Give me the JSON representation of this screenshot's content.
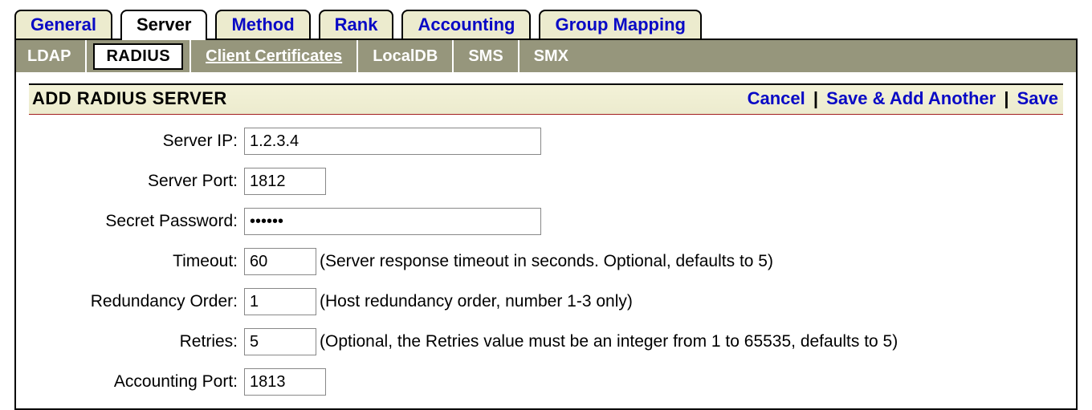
{
  "tabs": {
    "general": "General",
    "server": "Server",
    "method": "Method",
    "rank": "Rank",
    "accounting": "Accounting",
    "group_mapping": "Group Mapping"
  },
  "subtabs": {
    "ldap": "LDAP",
    "radius": "RADIUS",
    "clientc": "Client Certificates",
    "localdb": "LocalDB",
    "sms": "SMS",
    "smx": "SMX"
  },
  "header": {
    "title": "ADD RADIUS SERVER",
    "cancel": "Cancel",
    "save_add": "Save & Add Another",
    "save": "Save",
    "sep": "|"
  },
  "form": {
    "server_ip": {
      "label": "Server IP:",
      "value": "1.2.3.4"
    },
    "server_port": {
      "label": "Server Port:",
      "value": "1812"
    },
    "secret_password": {
      "label": "Secret Password:",
      "value": "xxxxxx"
    },
    "timeout": {
      "label": "Timeout:",
      "value": "60",
      "hint": "(Server response timeout in seconds. Optional, defaults to 5)"
    },
    "redundancy": {
      "label": "Redundancy Order:",
      "value": "1",
      "hint": "(Host redundancy order, number 1-3 only)"
    },
    "retries": {
      "label": "Retries:",
      "value": "5",
      "hint": "(Optional, the Retries value must be an integer from 1 to 65535, defaults to 5)"
    },
    "acct_port": {
      "label": "Accounting Port:",
      "value": "1813"
    }
  }
}
